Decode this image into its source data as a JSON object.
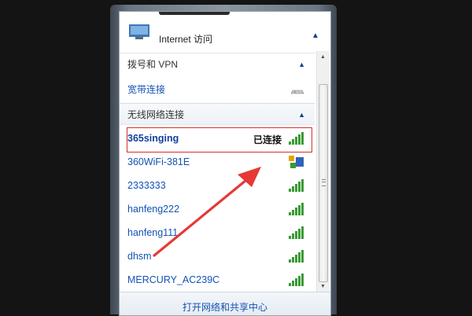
{
  "header": {
    "internet_access": "Internet 访问"
  },
  "sections": {
    "dialup_vpn": "拨号和 VPN",
    "wireless": "无线网络连接"
  },
  "broadband": {
    "label": "宽带连接"
  },
  "networks": [
    {
      "ssid": "365singing",
      "status": "已连接",
      "connected": true,
      "signal": "full"
    },
    {
      "ssid": "360WiFi-381E",
      "status": "",
      "connected": false,
      "signal": "shield"
    },
    {
      "ssid": "2333333",
      "status": "",
      "connected": false,
      "signal": "full"
    },
    {
      "ssid": "hanfeng222",
      "status": "",
      "connected": false,
      "signal": "full"
    },
    {
      "ssid": "hanfeng111",
      "status": "",
      "connected": false,
      "signal": "full"
    },
    {
      "ssid": "dhsm",
      "status": "",
      "connected": false,
      "signal": "full"
    },
    {
      "ssid": "MERCURY_AC239C",
      "status": "",
      "connected": false,
      "signal": "full"
    }
  ],
  "footer": {
    "open_center": "打开网络和共享中心"
  },
  "colors": {
    "link": "#1452b4",
    "highlight": "#d32f2f",
    "signal": "#3a9a35"
  }
}
